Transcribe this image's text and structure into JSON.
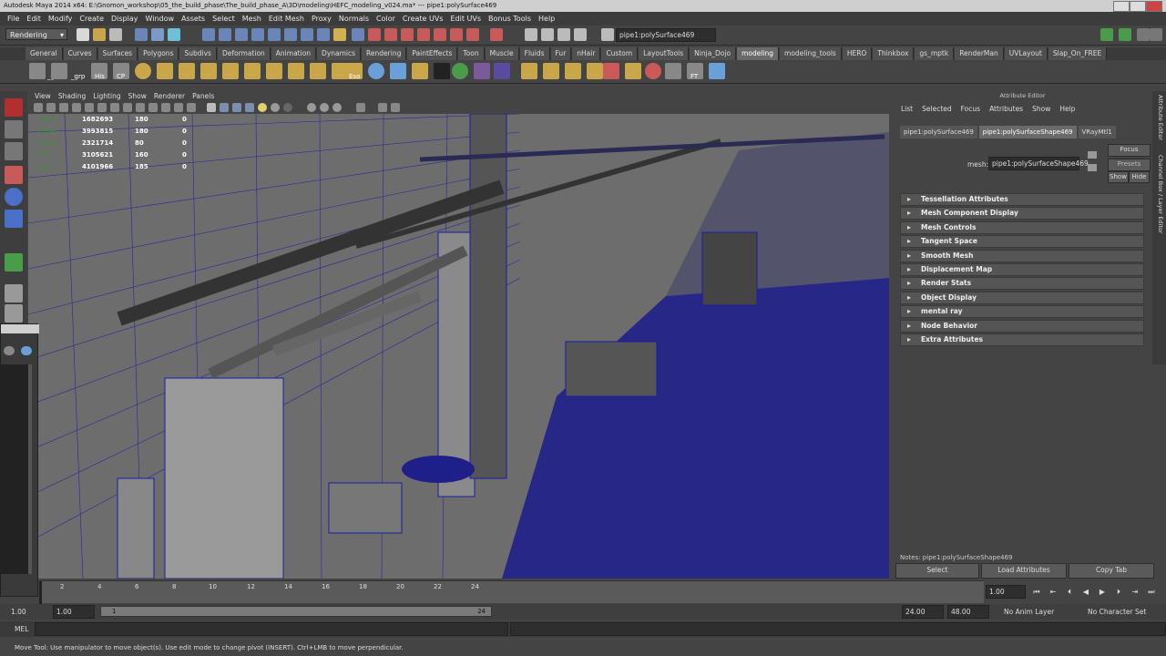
{
  "window": {
    "title": "Autodesk Maya 2014 x64: E:\\Gnomon_workshop\\05_the_build_phase\\The_build_phase_A\\3D\\modeling\\HEFC_modeling_v024.ma*   ---   pipe1:polySurface469"
  },
  "menubar": [
    "File",
    "Edit",
    "Modify",
    "Create",
    "Display",
    "Window",
    "Assets",
    "Select",
    "Mesh",
    "Edit Mesh",
    "Proxy",
    "Normals",
    "Color",
    "Create UVs",
    "Edit UVs",
    "Bonus Tools",
    "Help"
  ],
  "status_line": {
    "menuset": "Rendering",
    "selected_object": "pipe1:polySurface469"
  },
  "shelf": {
    "tabs": [
      "General",
      "Curves",
      "Surfaces",
      "Polygons",
      "Subdivs",
      "Deformation",
      "Animation",
      "Dynamics",
      "Rendering",
      "PaintEffects",
      "Toon",
      "Muscle",
      "Fluids",
      "Fur",
      "nHair",
      "Custom",
      "LayoutTools",
      "Ninja_Dojo",
      "modeling",
      "modeling_tools",
      "HERO",
      "Thinkbox",
      "gs_mptk",
      "RenderMan",
      "UVLayout",
      "Slap_On_FREE"
    ],
    "active_tab": "modeling",
    "icon_labels": [
      "_geo",
      "_grp",
      "His",
      "CP",
      "Eso",
      "FT"
    ]
  },
  "viewport": {
    "menu": [
      "View",
      "Shading",
      "Lighting",
      "Show",
      "Renderer",
      "Panels"
    ],
    "hud": [
      {
        "label": "Verts:",
        "a": "1682693",
        "b": "180",
        "c": "0"
      },
      {
        "label": "Edges:",
        "a": "3993815",
        "b": "180",
        "c": "0"
      },
      {
        "label": "Faces:",
        "a": "2321714",
        "b": "80",
        "c": "0"
      },
      {
        "label": "Tris:",
        "a": "3105621",
        "b": "160",
        "c": "0"
      },
      {
        "label": "UVs:",
        "a": "4101966",
        "b": "185",
        "c": "0"
      }
    ],
    "colors": {
      "wire": "#1c1ca0",
      "background": "#6a6a6a",
      "accent_green": "#3a8f3a"
    }
  },
  "attribute_editor": {
    "title": "Attribute Editor",
    "menu": [
      "List",
      "Selected",
      "Focus",
      "Attributes",
      "Show",
      "Help"
    ],
    "tabs": [
      "pipe1:polySurface469",
      "pipe1:polySurfaceShape469",
      "VRayMtl1"
    ],
    "active_tab": "pipe1:polySurfaceShape469",
    "mesh_label": "mesh:",
    "mesh_value": "pipe1:polySurfaceShape469",
    "focus_label": "Focus",
    "presets_label": "Presets",
    "show_label": "Show",
    "hide_label": "Hide",
    "sections": [
      "Tessellation Attributes",
      "Mesh Component Display",
      "Mesh Controls",
      "Tangent Space",
      "Smooth Mesh",
      "Displacement Map",
      "Render Stats",
      "Object Display",
      "mental ray",
      "Node Behavior",
      "Extra Attributes"
    ],
    "notes": "Notes: pipe1:polySurfaceShape469",
    "buttons": [
      "Select",
      "Load Attributes",
      "Copy Tab"
    ]
  },
  "side_tabs": [
    "Attribute Editor",
    "Channel Box / Layer Editor"
  ],
  "time_slider": {
    "ticks": [
      "2",
      "4",
      "6",
      "8",
      "10",
      "12",
      "14",
      "16",
      "18",
      "20",
      "22",
      "24"
    ],
    "current_frame": "1.00"
  },
  "range_slider": {
    "start": "1.00",
    "inner_start": "1.00",
    "range_start": "1",
    "range_end": "24",
    "end": "24.00",
    "outer_end": "48.00",
    "anim_layer": "No Anim Layer",
    "character_set": "No Character Set"
  },
  "command_line": {
    "label": "MEL"
  },
  "help_line": "Move Tool: Use manipulator to move object(s). Use edit mode to change pivot (INSERT). Ctrl+LMB to move perpendicular."
}
